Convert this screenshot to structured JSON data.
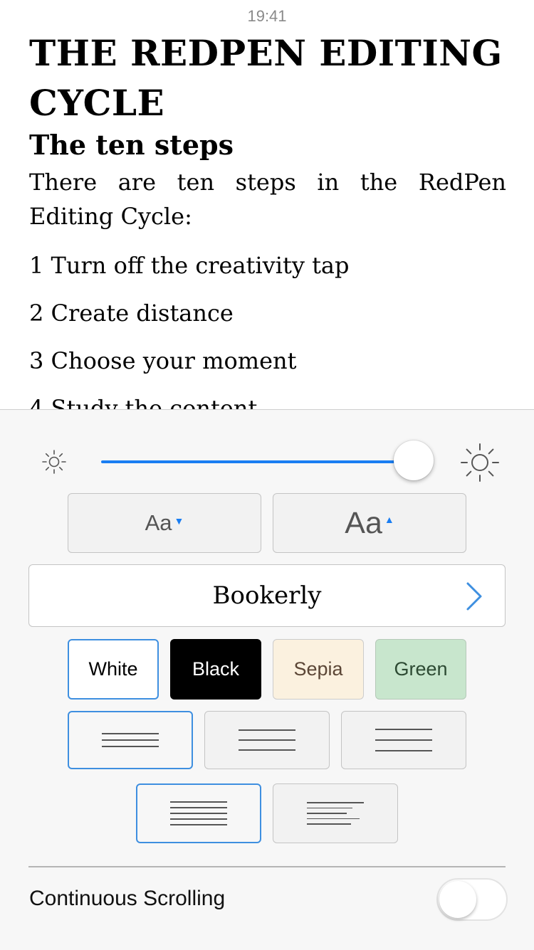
{
  "status_bar": {
    "time": "19:41"
  },
  "book": {
    "title_line1": "THE REDPEN EDITING",
    "title_line2": "CYCLE",
    "section_title": "The ten steps",
    "intro": "There are ten steps in the RedPen Editing Cycle:",
    "steps": [
      "1 Turn off the creativity tap",
      "2 Create distance",
      "3 Choose your moment",
      "4 Study the content"
    ]
  },
  "settings": {
    "brightness": {
      "level": 0.88,
      "low_icon": "sun-small-icon",
      "high_icon": "sun-large-icon"
    },
    "font_size": {
      "decrease_label": "Aa",
      "increase_label": "Aa"
    },
    "font_family": {
      "current": "Bookerly",
      "chevron_icon": "chevron-right-icon"
    },
    "themes": {
      "selected": "White",
      "items": [
        "White",
        "Black",
        "Sepia",
        "Green"
      ]
    },
    "colors": {
      "accent": "#1a7ef2",
      "selection": "#3e8fe0",
      "sepia_bg": "#fbf1df",
      "green_bg": "#c8e6cd"
    },
    "margins": {
      "selected": "narrow",
      "options": [
        "narrow",
        "medium",
        "wide"
      ]
    },
    "alignment": {
      "selected": "justified",
      "options": [
        "justified",
        "left"
      ]
    },
    "continuous_scrolling": {
      "label": "Continuous Scrolling",
      "enabled": false
    }
  }
}
